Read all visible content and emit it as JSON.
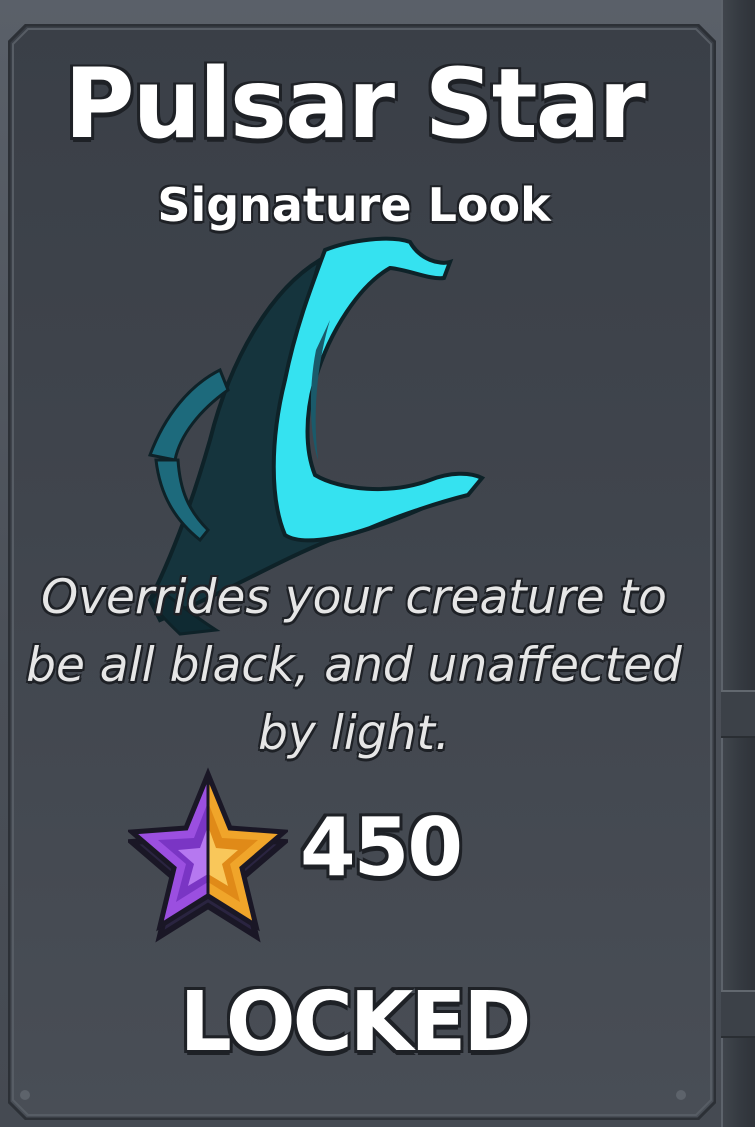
{
  "item": {
    "name": "Pulsar Star",
    "type": "Signature Look",
    "description": "Overrides your creature to be all black, and unaffected by light.",
    "cost": "450",
    "currency_icon": "star-icon",
    "status": "LOCKED",
    "preview_icon": "horn-icon"
  },
  "colors": {
    "horn_glow": "#33e0ee",
    "horn_dark": "#1a5a6a",
    "currency_purple": "#9b4fe0",
    "currency_orange": "#f0a52a",
    "card_background": "#40454d"
  }
}
